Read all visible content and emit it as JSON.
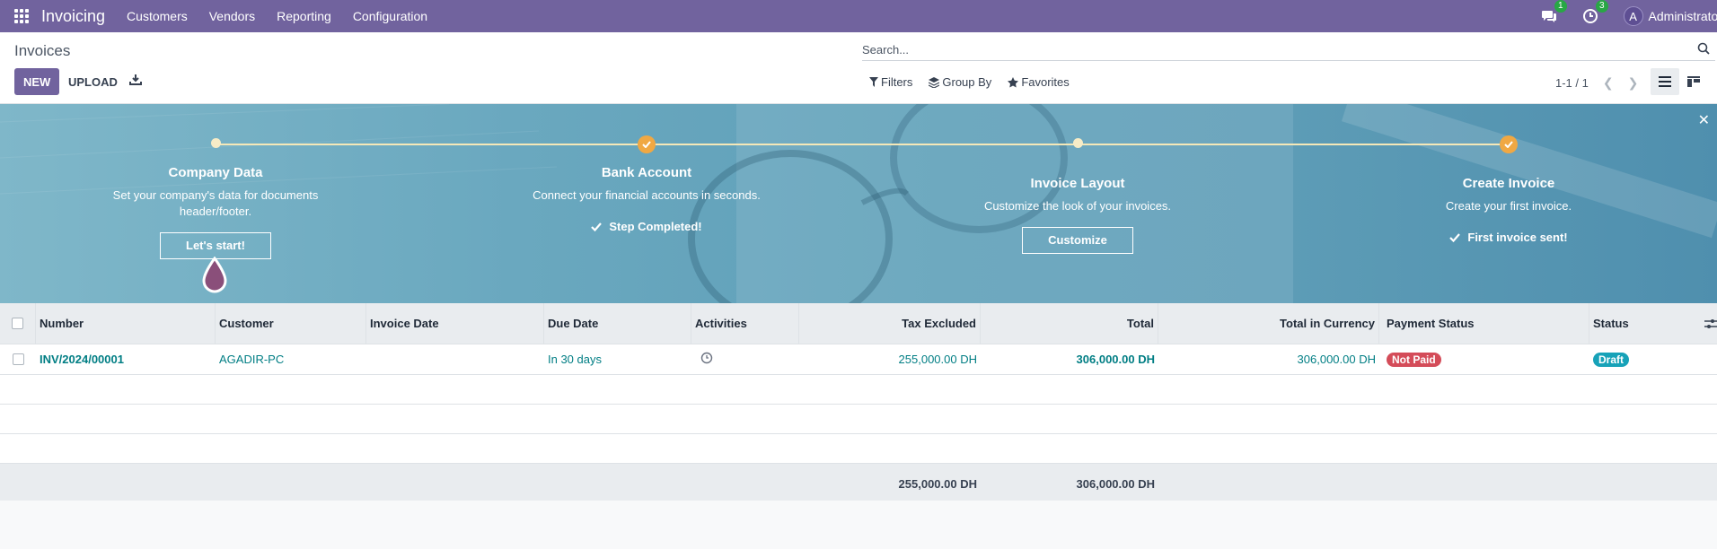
{
  "navbar": {
    "app_name": "Invoicing",
    "menu": [
      "Customers",
      "Vendors",
      "Reporting",
      "Configuration"
    ],
    "messages_count": "1",
    "activities_count": "3",
    "user_initial": "A",
    "user_name": "Administrator"
  },
  "control": {
    "title": "Invoices",
    "new_label": "NEW",
    "upload_label": "UPLOAD",
    "search_placeholder": "Search...",
    "filters_label": "Filters",
    "groupby_label": "Group By",
    "favorites_label": "Favorites",
    "pager": "1-1 / 1"
  },
  "onboarding": {
    "steps": [
      {
        "title": "Company Data",
        "desc": "Set your company's data for documents header/footer.",
        "button": "Let's start!",
        "state": "todo"
      },
      {
        "title": "Bank Account",
        "desc": "Connect your financial accounts in seconds.",
        "done": "Step Completed!",
        "state": "done"
      },
      {
        "title": "Invoice Layout",
        "desc": "Customize the look of your invoices.",
        "button": "Customize",
        "state": "todo"
      },
      {
        "title": "Create Invoice",
        "desc": "Create your first invoice.",
        "done": "First invoice sent!",
        "state": "done"
      }
    ]
  },
  "table": {
    "columns": [
      "Number",
      "Customer",
      "Invoice Date",
      "Due Date",
      "Activities",
      "Tax Excluded",
      "Total",
      "Total in Currency",
      "Payment Status",
      "Status"
    ],
    "rows": [
      {
        "number": "INV/2024/00001",
        "customer": "AGADIR-PC",
        "invoice_date": "",
        "due_date": "In 30 days",
        "tax_excluded": "255,000.00 DH",
        "total": "306,000.00 DH",
        "total_currency": "306,000.00 DH",
        "payment_status": "Not Paid",
        "status": "Draft"
      }
    ],
    "footer": {
      "tax_excluded": "255,000.00 DH",
      "total": "306,000.00 DH"
    }
  },
  "colors": {
    "brand": "#71639e",
    "link": "#017e84",
    "not_paid": "#d44c59",
    "draft": "#17a2b8",
    "step_done": "#f0a843"
  }
}
